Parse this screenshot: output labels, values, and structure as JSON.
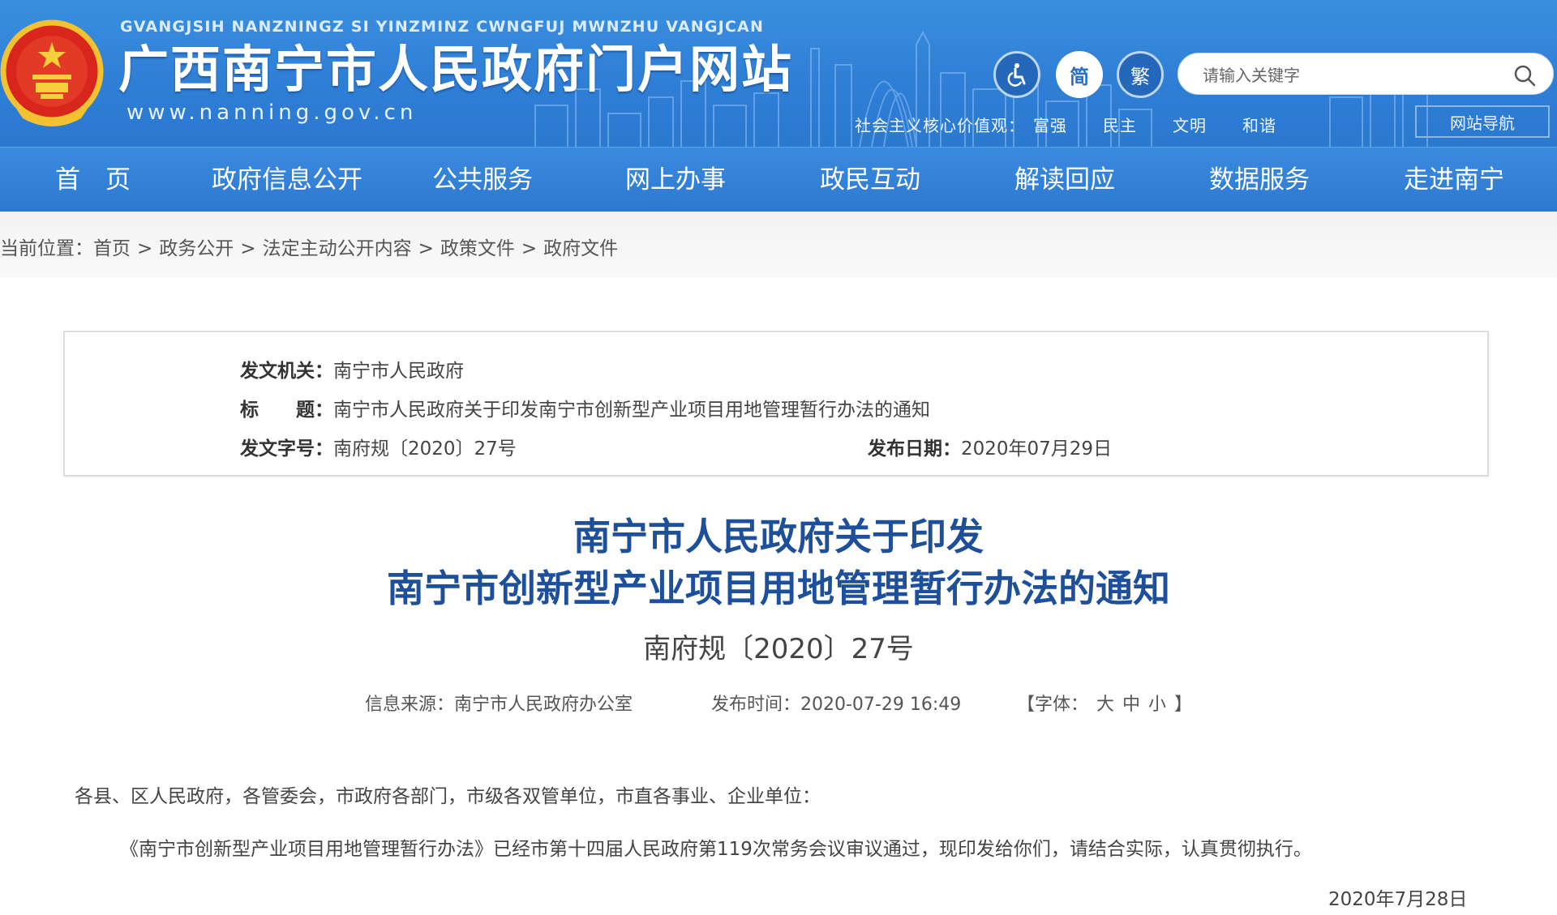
{
  "header": {
    "pinyin": "GVANGJSIH NANZNINGZ SI YINZMINZ CWNGFUJ MWNZHU VANGJCAN",
    "title": "广西南宁市人民政府门户网站",
    "url": "www.nanning.gov.cn",
    "simplified_label": "简",
    "traditional_label": "繁",
    "search_placeholder": "请输入关键字",
    "core_values_label": "社会主义核心价值观：",
    "core_values": [
      "富强",
      "民主",
      "文明",
      "和谐"
    ],
    "site_map_label": "网站导航"
  },
  "nav": {
    "items": [
      "首　页",
      "政府信息公开",
      "公共服务",
      "网上办事",
      "政民互动",
      "解读回应",
      "数据服务",
      "走进南宁"
    ]
  },
  "breadcrumb": {
    "prefix": "当前位置：",
    "items": [
      "首页",
      "政务公开",
      "法定主动公开内容",
      "政策文件",
      "政府文件"
    ],
    "separator": ">"
  },
  "info": {
    "issuer_label": "发文机关：",
    "issuer": "南宁市人民政府",
    "title_label": "标　　题：",
    "title": "南宁市人民政府关于印发南宁市创新型产业项目用地管理暂行办法的通知",
    "doc_no_label": "发文字号：",
    "doc_no": "南府规〔2020〕27号",
    "date_label": "发布日期：",
    "date": "2020年07月29日"
  },
  "article": {
    "title_line1": "南宁市人民政府关于印发",
    "title_line2": "南宁市创新型产业项目用地管理暂行办法的通知",
    "doc_number": "南府规〔2020〕27号",
    "source": "信息来源：南宁市人民政府办公室",
    "published": "发布时间：2020-07-29 16:49",
    "font_size_open": "【字体：",
    "font_large": "大",
    "font_medium": "中",
    "font_small": "小",
    "font_size_close": "】",
    "salutation": "各县、区人民政府，各管委会，市政府各部门，市级各双管单位，市直各事业、企业单位：",
    "paragraph1": "《南宁市创新型产业项目用地管理暂行办法》已经市第十四届人民政府第119次常务会议审议通过，现印发给你们，请结合实际，认真贯彻执行。",
    "sign_date": "2020年7月28日"
  },
  "colors": {
    "header_blue": "#2f7fd6",
    "title_blue": "#1d4f9a"
  }
}
